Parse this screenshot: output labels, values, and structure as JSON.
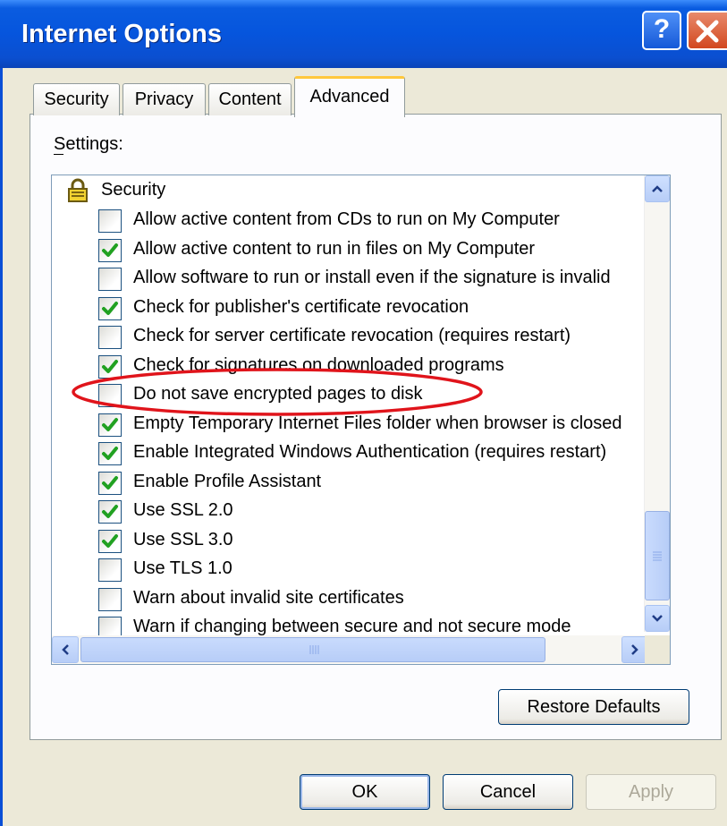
{
  "window": {
    "title": "Internet Options",
    "help_label": "?",
    "close_label": "✕"
  },
  "tabs": [
    {
      "label": "Security"
    },
    {
      "label": "Privacy"
    },
    {
      "label": "Content"
    },
    {
      "label": "Advanced"
    }
  ],
  "settings_label": "Settings:",
  "list": {
    "group": "Security",
    "group_icon": "padlock-icon",
    "items": [
      {
        "label": "Allow active content from CDs to run on My Computer",
        "checked": false
      },
      {
        "label": "Allow active content to run in files on My Computer",
        "checked": true
      },
      {
        "label": "Allow software to run or install even if the signature is invalid",
        "checked": false
      },
      {
        "label": "Check for publisher's certificate revocation",
        "checked": true
      },
      {
        "label": "Check for server certificate revocation (requires restart)",
        "checked": false
      },
      {
        "label": "Check for signatures on downloaded programs",
        "checked": true
      },
      {
        "label": "Do not save encrypted pages to disk",
        "checked": false
      },
      {
        "label": "Empty Temporary Internet Files folder when browser is closed",
        "checked": true
      },
      {
        "label": "Enable Integrated Windows Authentication (requires restart)",
        "checked": true
      },
      {
        "label": "Enable Profile Assistant",
        "checked": true
      },
      {
        "label": "Use SSL 2.0",
        "checked": true
      },
      {
        "label": "Use SSL 3.0",
        "checked": true
      },
      {
        "label": "Use TLS 1.0",
        "checked": false
      },
      {
        "label": "Warn about invalid site certificates",
        "checked": false
      },
      {
        "label": "Warn if changing between secure and not secure mode",
        "checked": false
      }
    ],
    "highlighted_item": "Do not save encrypted pages to disk"
  },
  "buttons": {
    "restore_defaults": "Restore Defaults",
    "ok": "OK",
    "cancel": "Cancel",
    "apply": "Apply"
  },
  "colors": {
    "titlebar": "#0655dd",
    "check": "#21a121",
    "annotation": "#e0141b",
    "active_tab_accent": "#ffc83c"
  }
}
